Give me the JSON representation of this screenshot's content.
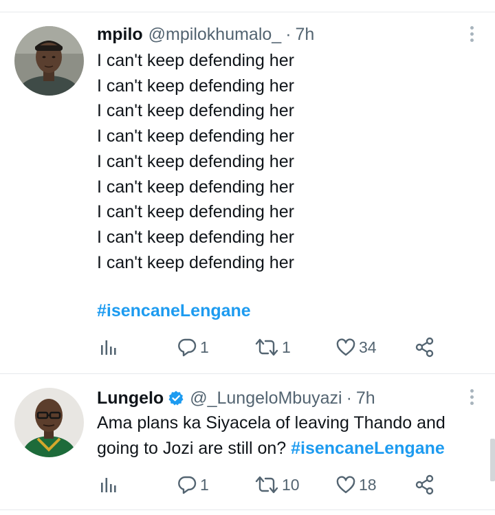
{
  "tweets": [
    {
      "name": "mpilo",
      "handle": "@mpilokhumalo_",
      "separator": "·",
      "time": "7h",
      "lines": [
        "I can't keep defending her",
        "I can't keep defending her",
        "I can't keep defending her",
        "I can't keep defending her",
        "I can't keep defending her",
        "I can't keep defending her",
        "I can't keep defending her",
        "I can't keep defending her",
        "I can't keep defending her"
      ],
      "hashtag": "#isencaneLengane",
      "actions": {
        "views": "",
        "replies": "1",
        "retweets": "1",
        "likes": "34"
      },
      "verified": false
    },
    {
      "name": "Lungelo",
      "handle": "@_LungeloMbuyazi",
      "separator": "·",
      "time": "7h",
      "text": "Ama plans ka Siyacela of leaving Thando and going to Jozi are still on?",
      "hashtag": "#isencaneLengane",
      "actions": {
        "views": "",
        "replies": "1",
        "retweets": "10",
        "likes": "18"
      },
      "verified": true
    }
  ],
  "colors": {
    "accent": "#1d9bf0",
    "text": "#0f1419",
    "muted": "#536471",
    "divider": "#e6e9ec"
  },
  "icons": [
    "views-icon",
    "reply-icon",
    "retweet-icon",
    "like-icon",
    "share-icon",
    "more-icon",
    "verified-icon"
  ]
}
